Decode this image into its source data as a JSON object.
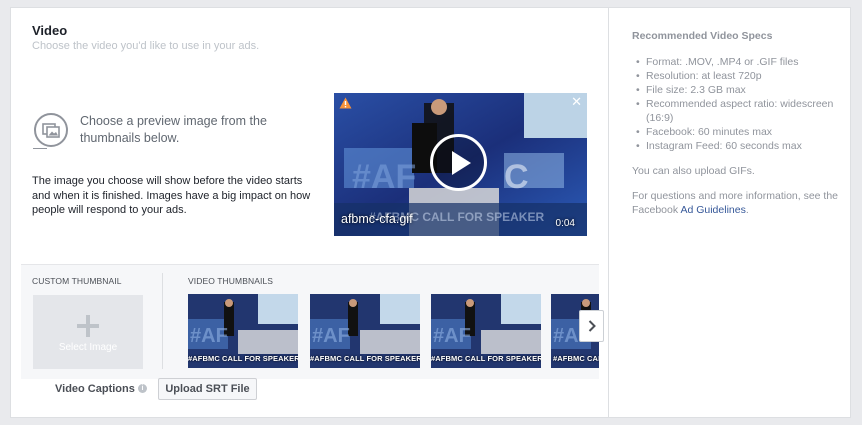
{
  "video_section": {
    "title": "Video",
    "subtitle": "Choose the video you'd like to use in your ads."
  },
  "preview": {
    "prompt": "Choose a preview image from the thumbnails below.",
    "description": "The image you choose will show before the video starts and when it is finished. Images have a big impact on how people will respond to your ads."
  },
  "video_player": {
    "filename": "afbmc-cfa.gif",
    "duration": "0:04",
    "close_glyph": "✕"
  },
  "thumbnails": {
    "custom_label": "CUSTOM THUMBNAIL",
    "select_image_label": "Select Image",
    "video_label": "VIDEO THUMBNAILS",
    "items": [
      {
        "caption": "#AFBMC CALL FOR SPEAKER"
      },
      {
        "caption": "#AFBMC CALL FOR SPEAKER"
      },
      {
        "caption": "#AFBMC CALL FOR SPEAKER"
      },
      {
        "caption": "#AFBMC CALL FOR SPEAKER"
      }
    ]
  },
  "captions": {
    "label": "Video Captions",
    "info_glyph": "i",
    "upload_button": "Upload SRT File"
  },
  "specs": {
    "title": "Recommended Video Specs",
    "items": [
      "Format: .MOV, .MP4 or .GIF files",
      "Resolution: at least 720p",
      "File size: 2.3 GB max",
      "Recommended aspect ratio: widescreen (16:9)",
      "Facebook: 60 minutes max",
      "Instagram Feed: 60 seconds max"
    ],
    "also_gif": "You can also upload GIFs.",
    "more_info_prefix": "For questions and more information, see the Facebook ",
    "more_info_link": "Ad Guidelines",
    "more_info_suffix": "."
  },
  "colors": {
    "link": "#365899",
    "muted": "#90949c",
    "warning": "#f7923a"
  }
}
